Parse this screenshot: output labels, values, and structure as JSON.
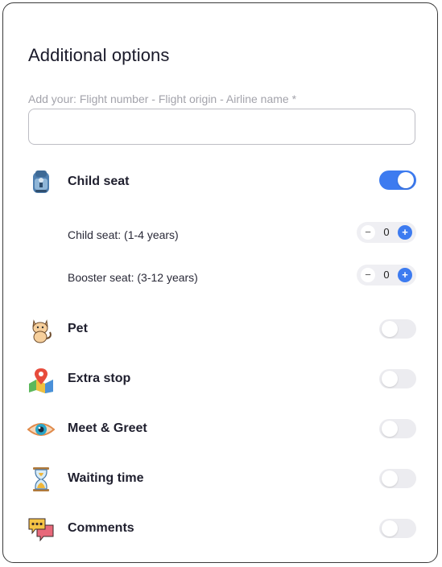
{
  "title": "Additional options",
  "flight_hint": "Add your: Flight number - Flight origin - Airline name *",
  "flight_input": {
    "value": "",
    "placeholder": ""
  },
  "child_seat": {
    "label": "Child seat",
    "enabled": true,
    "icon": "child-seat-icon",
    "sub_options": [
      {
        "label": "Child seat: (1-4 years)",
        "value": "0",
        "minus": "−",
        "plus": "+"
      },
      {
        "label": "Booster seat: (3-12 years)",
        "value": "0",
        "minus": "−",
        "plus": "+"
      }
    ]
  },
  "options": [
    {
      "label": "Pet",
      "enabled": false,
      "icon": "cat-icon"
    },
    {
      "label": "Extra stop",
      "enabled": false,
      "icon": "map-pin-icon"
    },
    {
      "label": "Meet & Greet",
      "enabled": false,
      "icon": "eye-icon"
    },
    {
      "label": "Waiting time",
      "enabled": false,
      "icon": "hourglass-icon"
    },
    {
      "label": "Comments",
      "enabled": false,
      "icon": "chat-bubbles-icon"
    }
  ],
  "colors": {
    "accent": "#3d7bf0",
    "toggle_off": "#ececf0",
    "text": "#1f1f2e",
    "hint": "#a3a3ab"
  }
}
